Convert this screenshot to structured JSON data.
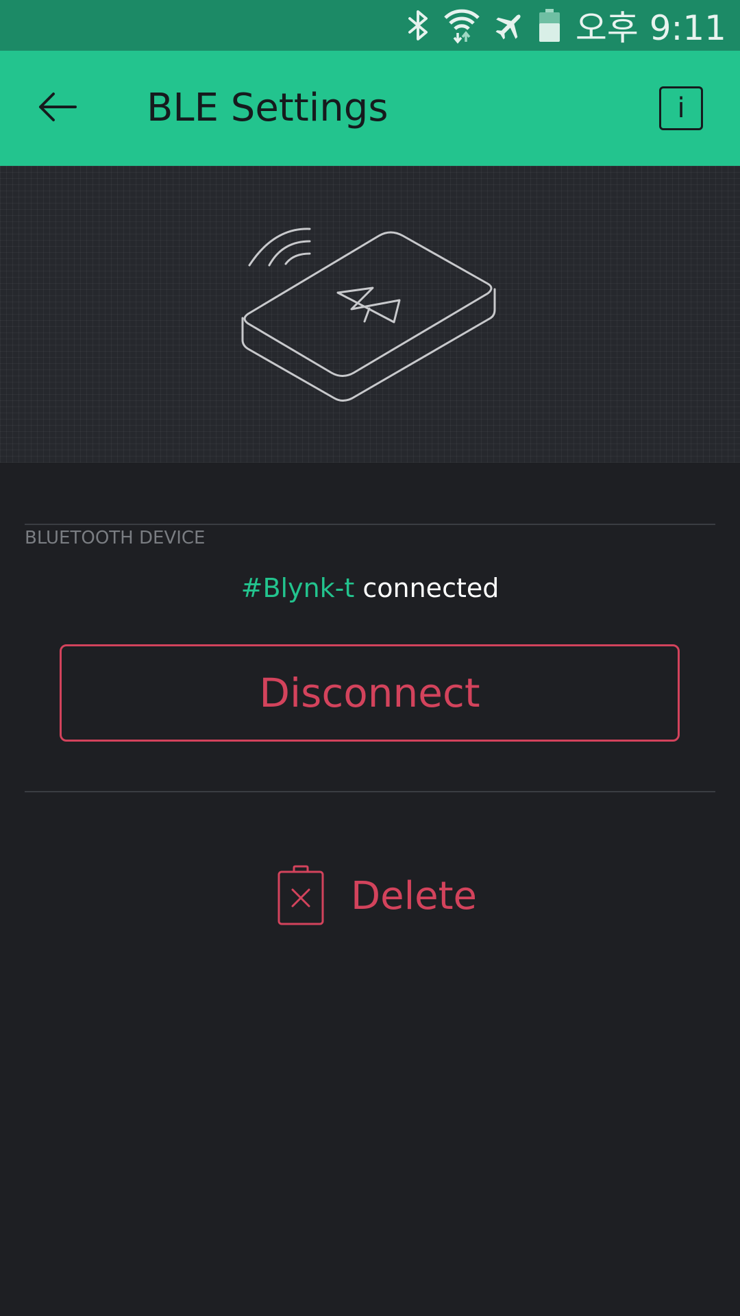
{
  "status_bar": {
    "time": "오후 9:11",
    "icons": [
      "bluetooth-icon",
      "wifi-icon",
      "airplane-mode-icon",
      "battery-icon"
    ]
  },
  "app_bar": {
    "title": "BLE Settings",
    "back_icon": "arrow-left-icon",
    "info_label": "i"
  },
  "hero": {
    "illustration": "ble-device-illustration"
  },
  "bluetooth_section": {
    "label": "BLUETOOTH DEVICE",
    "device_name": "#Blynk-t",
    "status_text": " connected",
    "disconnect_label": "Disconnect"
  },
  "actions": {
    "delete_label": "Delete",
    "delete_icon": "trash-icon"
  },
  "colors": {
    "accent": "#23c48e",
    "status_bar": "#1c8a66",
    "danger": "#d3435c",
    "background": "#1e1f23"
  }
}
